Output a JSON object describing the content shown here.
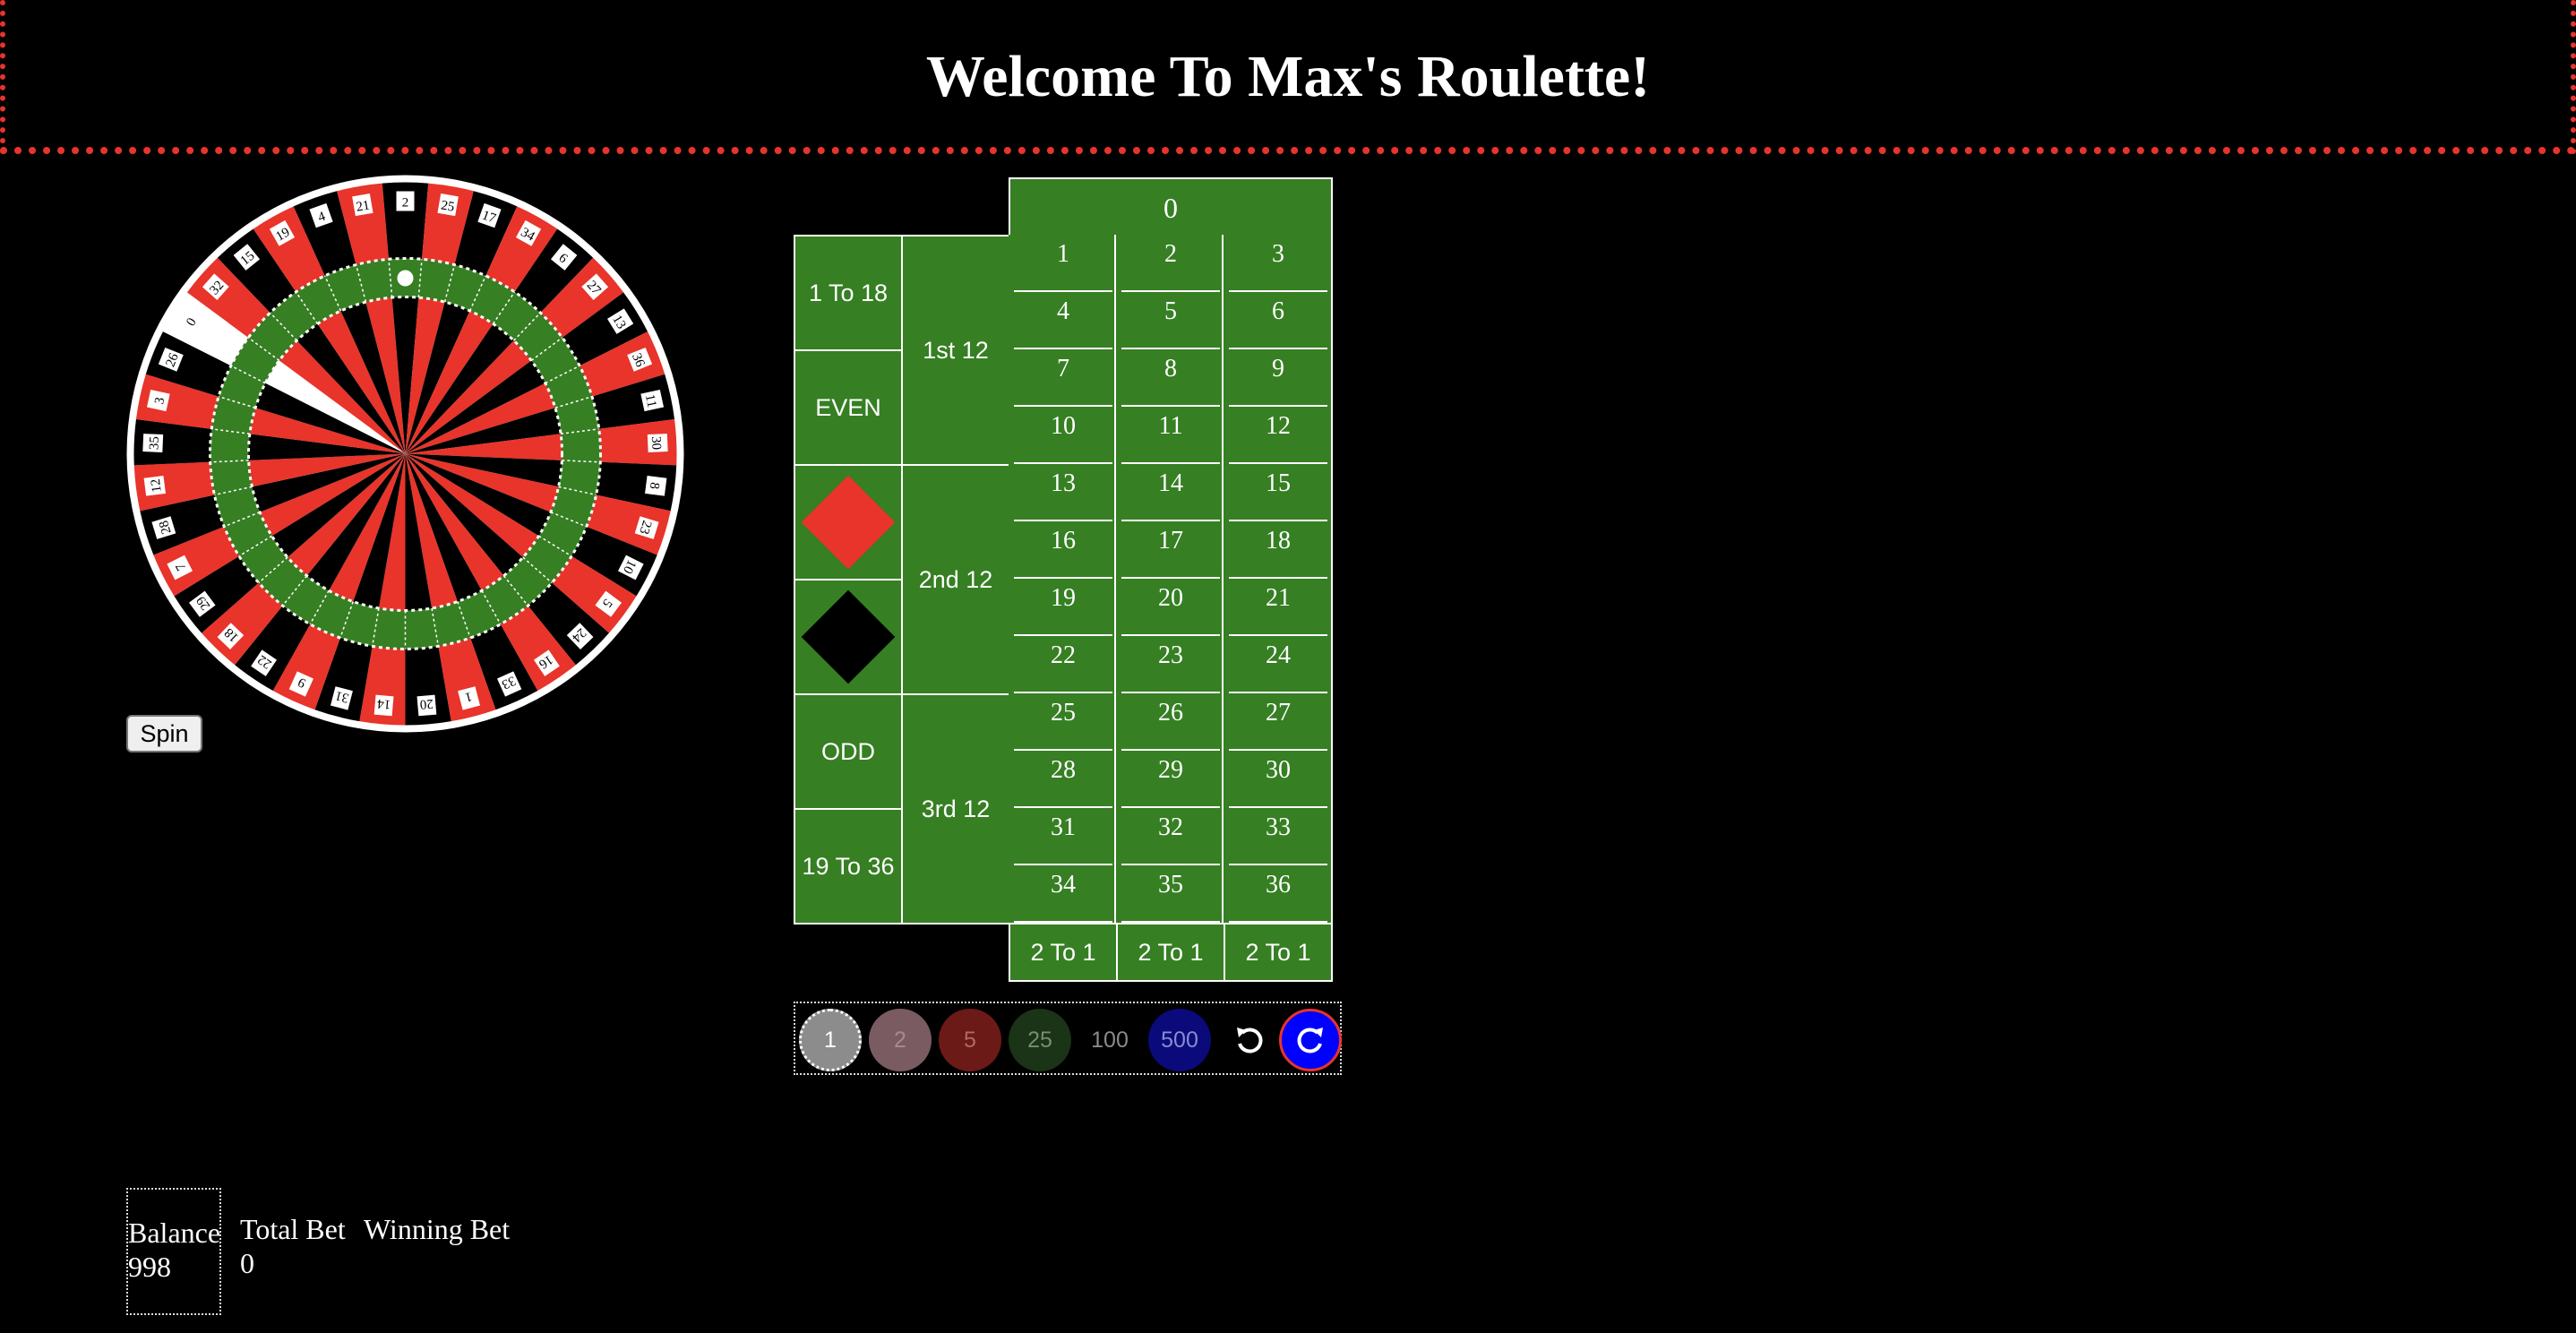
{
  "header": {
    "title": "Welcome To Max's Roulette!"
  },
  "wheel": {
    "numbers": [
      "0",
      "32",
      "15",
      "19",
      "4",
      "21",
      "2",
      "25",
      "17",
      "34",
      "6",
      "27",
      "13",
      "36",
      "11",
      "30",
      "8",
      "23",
      "10",
      "5",
      "24",
      "16",
      "33",
      "1",
      "20",
      "14",
      "31",
      "9",
      "22",
      "18",
      "29",
      "7",
      "28",
      "12",
      "35",
      "3",
      "26"
    ],
    "colors": {
      "red": "#e8342a",
      "black": "#000000",
      "green": "#367f23",
      "rim": "#ffffff"
    }
  },
  "spin": {
    "label": "Spin"
  },
  "board": {
    "zero": "0",
    "rows": [
      [
        "1",
        "2",
        "3"
      ],
      [
        "4",
        "5",
        "6"
      ],
      [
        "7",
        "8",
        "9"
      ],
      [
        "10",
        "11",
        "12"
      ],
      [
        "13",
        "14",
        "15"
      ],
      [
        "16",
        "17",
        "18"
      ],
      [
        "19",
        "20",
        "21"
      ],
      [
        "22",
        "23",
        "24"
      ],
      [
        "25",
        "26",
        "27"
      ],
      [
        "28",
        "29",
        "30"
      ],
      [
        "31",
        "32",
        "33"
      ],
      [
        "34",
        "35",
        "36"
      ]
    ],
    "outside": {
      "low": "1 To 18",
      "even": "EVEN",
      "red": "red",
      "black": "black",
      "odd": "ODD",
      "high": "19 To 36"
    },
    "dozens": {
      "first": "1st 12",
      "second": "2nd 12",
      "third": "3rd 12"
    },
    "columns": [
      "2 To 1",
      "2 To 1",
      "2 To 1"
    ],
    "felt_color": "#367f23"
  },
  "chips": {
    "values": [
      "1",
      "2",
      "5",
      "25",
      "100",
      "500"
    ],
    "colors": [
      "#8c8c8c",
      "#7a5b61",
      "#6b1a17",
      "#1b3316",
      "#000000",
      "#0a0a7a"
    ],
    "undo_icon": "undo-icon",
    "redo_icon": "redo-icon"
  },
  "stats": {
    "balance_label": "Balance",
    "balance_value": "998",
    "total_bet_label": "Total Bet",
    "total_bet_value": "0",
    "winning_bet_label": "Winning Bet"
  }
}
